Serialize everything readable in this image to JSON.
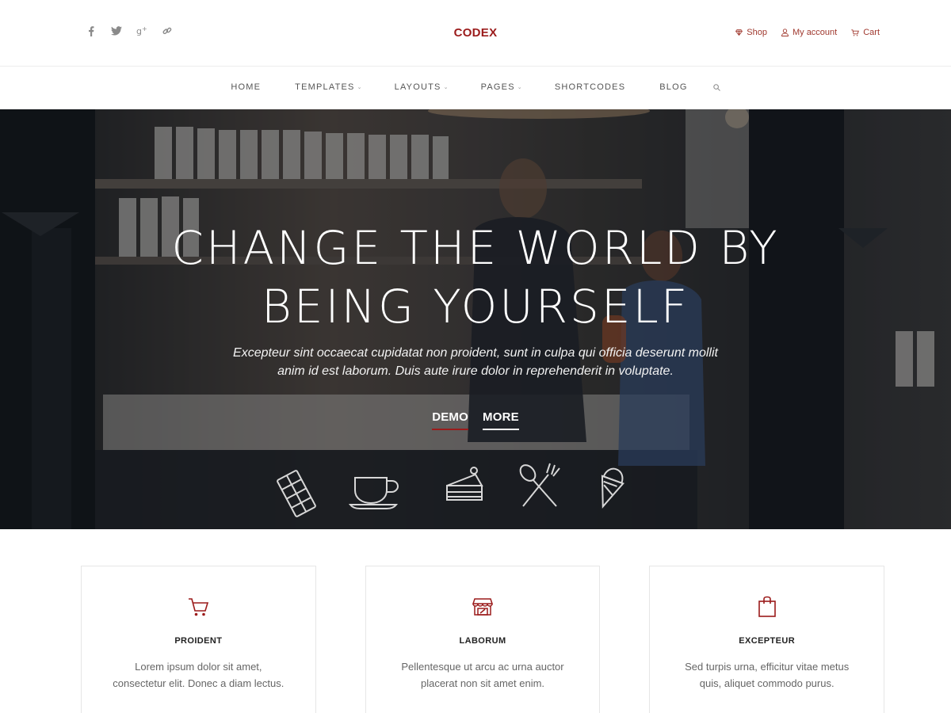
{
  "header": {
    "logo": "CODEX",
    "social_icons": [
      "facebook-icon",
      "twitter-icon",
      "google-plus-icon",
      "link-icon"
    ],
    "links": [
      {
        "label": "Shop",
        "icon": "diamond-icon"
      },
      {
        "label": "My account",
        "icon": "user-icon"
      },
      {
        "label": "Cart",
        "icon": "cart-icon"
      }
    ]
  },
  "nav": {
    "items": [
      {
        "label": "HOME",
        "dropdown": false
      },
      {
        "label": "TEMPLATES",
        "dropdown": true
      },
      {
        "label": "LAYOUTS",
        "dropdown": true
      },
      {
        "label": "PAGES",
        "dropdown": true
      },
      {
        "label": "SHORTCODES",
        "dropdown": false
      },
      {
        "label": "BLOG",
        "dropdown": false
      }
    ],
    "search_icon": "search-icon"
  },
  "hero": {
    "title_line1": "CHANGE THE WORLD BY",
    "title_line2": "BEING YOURSELF",
    "subtitle_line1": "Excepteur sint occaecat cupidatat non proident, sunt in culpa qui officia deserunt mollit",
    "subtitle_line2": "anim id est laborum. Duis aute irure dolor in reprehenderit in voluptate.",
    "button_demo": "DEMO",
    "button_more": "MORE",
    "icons": [
      "chocolate-bar-icon",
      "coffee-cup-icon",
      "cake-slice-icon",
      "fork-spoon-icon",
      "ice-cream-icon"
    ]
  },
  "cards": [
    {
      "icon": "shopping-cart-icon",
      "title": "PROIDENT",
      "text_line1": "Lorem ipsum dolor sit amet,",
      "text_line2": "consectetur elit. Donec a diam lectus."
    },
    {
      "icon": "storefront-icon",
      "title": "LABORUM",
      "text_line1": "Pellentesque ut arcu ac urna auctor",
      "text_line2": "placerat non sit amet enim."
    },
    {
      "icon": "shopping-bag-icon",
      "title": "EXCEPTEUR",
      "text_line1": "Sed turpis urna, efficitur vitae metus",
      "text_line2": "quis, aliquet commodo purus."
    }
  ],
  "colors": {
    "accent": "#9b1b1b",
    "link": "#a0392f",
    "hero_overlay": "#1a1c20"
  }
}
